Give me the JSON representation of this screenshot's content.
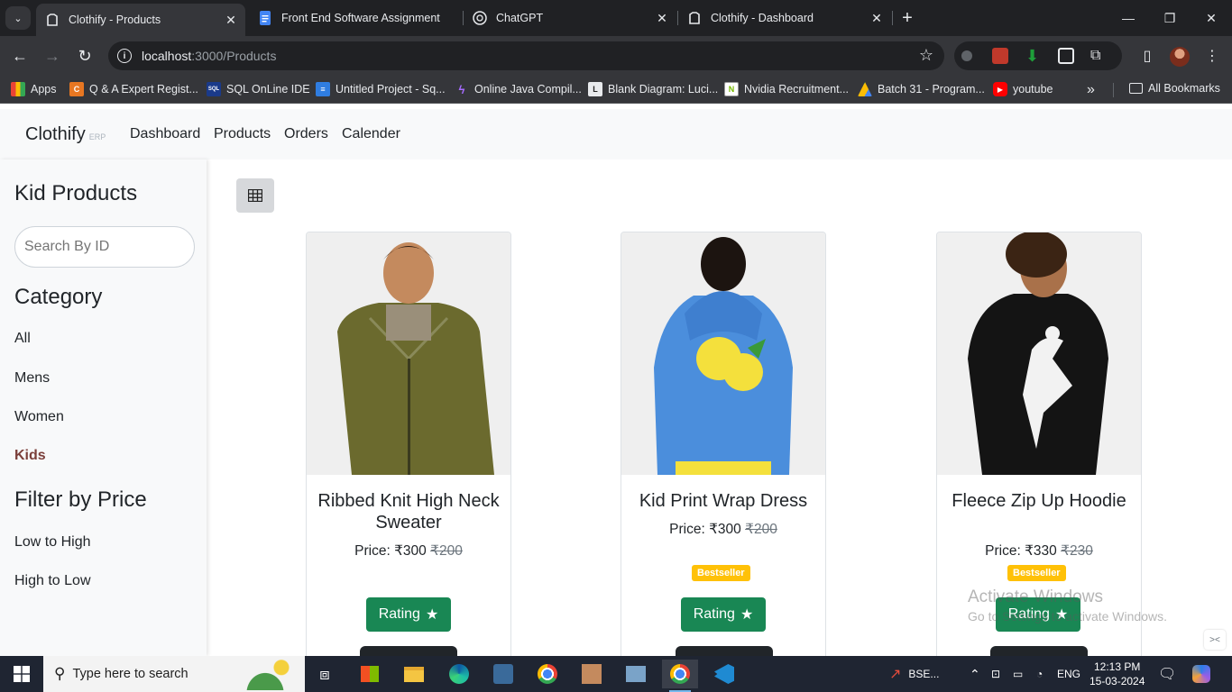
{
  "browser": {
    "tabs": [
      {
        "title": "Clothify - Products",
        "active": true
      },
      {
        "title": "Front End Software Assignment",
        "active": false
      },
      {
        "title": "ChatGPT",
        "active": false
      },
      {
        "title": "Clothify - Dashboard",
        "active": false
      }
    ],
    "url_host": "localhost",
    "url_path": ":3000/Products",
    "bookmarks": [
      {
        "label": "Apps",
        "icon": "apps-grid-icon",
        "color": "#4285f4"
      },
      {
        "label": "Q & A Expert Regist...",
        "icon": "chegg-icon",
        "color": "#e87722"
      },
      {
        "label": "SQL OnLine IDE",
        "icon": "sql-icon",
        "color": "#1a3a8a"
      },
      {
        "label": "Untitled Project - Sq...",
        "icon": "squarespace-icon",
        "color": "#2f7de1"
      },
      {
        "label": "Online Java Compil...",
        "icon": "bolt-icon",
        "color": "#7b3fe4"
      },
      {
        "label": "Blank Diagram: Luci...",
        "icon": "lucid-icon",
        "color": "#222222"
      },
      {
        "label": "Nvidia Recruitment...",
        "icon": "nvidia-icon",
        "color": "#ffffff"
      },
      {
        "label": "Batch 31 - Program...",
        "icon": "drive-icon",
        "color": "#fbbc04"
      },
      {
        "label": "youtube",
        "icon": "youtube-icon",
        "color": "#ff0000"
      }
    ],
    "all_bookmarks": "All Bookmarks"
  },
  "app": {
    "brand": "Clothify",
    "brand_sub": "ERP",
    "nav": [
      "Dashboard",
      "Products",
      "Orders",
      "Calender"
    ]
  },
  "sidebar": {
    "heading": "Kid Products",
    "search_placeholder": "Search By ID",
    "category_heading": "Category",
    "categories": [
      {
        "label": "All",
        "active": false
      },
      {
        "label": "Mens",
        "active": false
      },
      {
        "label": "Women",
        "active": false
      },
      {
        "label": "Kids",
        "active": true
      }
    ],
    "price_heading": "Filter by Price",
    "price_filters": [
      "Low to High",
      "High to Low"
    ]
  },
  "products": [
    {
      "title": "Ribbed Knit High Neck Sweater",
      "price_label": "Price: ₹300",
      "old_price": "₹200",
      "badge": "",
      "rating_label": "Rating"
    },
    {
      "title": "Kid Print Wrap Dress",
      "price_label": "Price: ₹300",
      "old_price": "₹200",
      "badge": "Bestseller",
      "rating_label": "Rating"
    },
    {
      "title": "Fleece Zip Up Hoodie",
      "price_label": "Price: ₹330",
      "old_price": "₹230",
      "badge": "Bestseller",
      "rating_label": "Rating"
    }
  ],
  "watermark": {
    "line1": "Activate Windows",
    "line2": "Go to Settings to activate Windows."
  },
  "taskbar": {
    "search_placeholder": "Type here to search",
    "stock_label": "BSE...",
    "language": "ENG",
    "time": "12:13 PM",
    "date": "15-03-2024"
  },
  "colors": {
    "accent_green": "#198754",
    "badge_yellow": "#ffc107",
    "active_category": "#7b3f3a"
  }
}
